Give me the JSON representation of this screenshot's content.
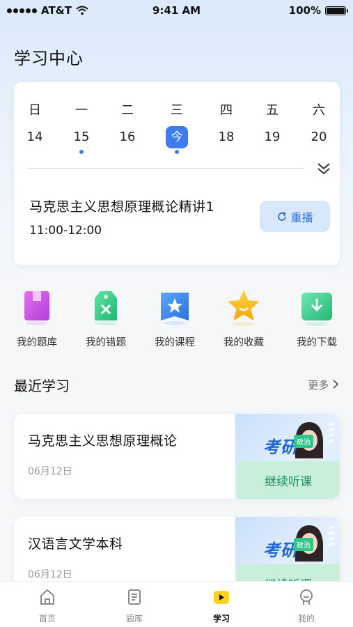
{
  "status_bar": {
    "carrier": "AT&T",
    "time": "9:41 AM",
    "battery": "100%"
  },
  "page": {
    "title": "学习中心"
  },
  "calendar": {
    "weekdays": [
      "日",
      "一",
      "二",
      "三",
      "四",
      "五",
      "六"
    ],
    "dates": [
      "14",
      "15",
      "16",
      "今",
      "18",
      "19",
      "20"
    ],
    "today_index": 3,
    "marked_indices": [
      1,
      3
    ],
    "accent_color": "#3f7cf0"
  },
  "lesson": {
    "title": "马克思主义思想原理概论精讲1",
    "time": "11:00-12:00",
    "replay_label": "重播"
  },
  "quick_entries": [
    {
      "label": "我的题库",
      "icon": "question-bank-icon"
    },
    {
      "label": "我的错题",
      "icon": "wrong-answers-icon"
    },
    {
      "label": "我的课程",
      "icon": "courses-icon"
    },
    {
      "label": "我的收藏",
      "icon": "favorites-star-icon"
    },
    {
      "label": "我的下载",
      "icon": "downloads-icon"
    }
  ],
  "recent": {
    "title": "最近学习",
    "more_label": "更多",
    "courses": [
      {
        "title": "马克思主义思想原理概论",
        "date": "06月12日",
        "continue_label": "继续听课",
        "thumb_text": "考研",
        "thumb_tag": "政治"
      },
      {
        "title": "汉语言文学本科",
        "date": "06月12日",
        "continue_label": "继续听课",
        "thumb_text": "考研",
        "thumb_tag": "政治"
      }
    ]
  },
  "tabbar": {
    "tabs": [
      {
        "label": "首页",
        "icon": "home-icon"
      },
      {
        "label": "题库",
        "icon": "document-icon"
      },
      {
        "label": "学习",
        "icon": "play-icon"
      },
      {
        "label": "我的",
        "icon": "profile-icon"
      }
    ],
    "active_index": 2,
    "active_color": "#ffd21f"
  }
}
